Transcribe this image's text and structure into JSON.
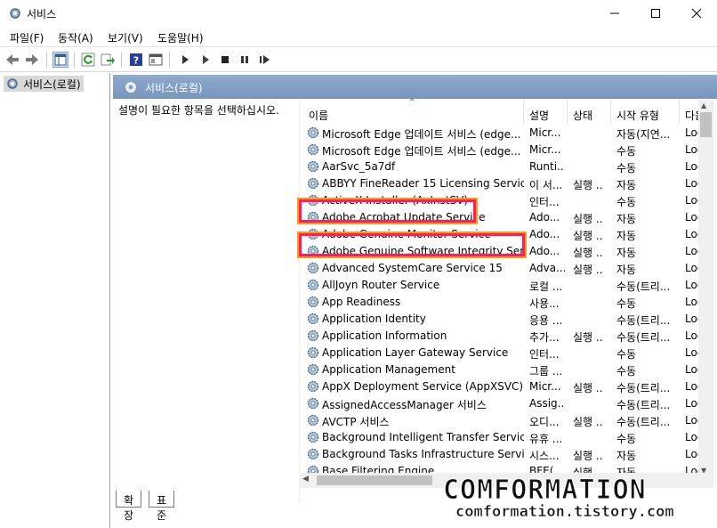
{
  "window": {
    "title": "서비스"
  },
  "menu": [
    "파일(F)",
    "동작(A)",
    "보기(V)",
    "도움말(H)"
  ],
  "tree": {
    "item": "서비스(로컬)"
  },
  "pane": {
    "header": "서비스(로컬)",
    "description": "설명이 필요한 항목을 선택하십시오."
  },
  "columns": {
    "name": "이름",
    "desc": "설명",
    "state": "상태",
    "startup": "시작 유형",
    "logon": "다음"
  },
  "services": [
    {
      "name": "Microsoft Edge 업데이트 서비스 (edge...",
      "desc": "Micr...",
      "state": "",
      "startup": "자동(지연...",
      "logon": "Loc"
    },
    {
      "name": "Microsoft Edge 업데이트 서비스 (edge...",
      "desc": "Micr...",
      "state": "",
      "startup": "수동",
      "logon": "Loc"
    },
    {
      "name": "AarSvc_5a7df",
      "desc": "Runti...",
      "state": "",
      "startup": "수동",
      "logon": "Loc"
    },
    {
      "name": "ABBYY FineReader 15 Licensing Service",
      "desc": "이 서...",
      "state": "실행 ...",
      "startup": "자동",
      "logon": "Loc"
    },
    {
      "name": "ActiveX Installer (AxInstSV)",
      "desc": "인터...",
      "state": "",
      "startup": "수동",
      "logon": "Loc"
    },
    {
      "name": "Adobe Acrobat Update Service",
      "desc": "Ado...",
      "state": "실행 ...",
      "startup": "자동",
      "logon": "Loc"
    },
    {
      "name": "Adobe Genuine Monitor Service",
      "desc": "Ado...",
      "state": "실행 ...",
      "startup": "자동",
      "logon": "Loc"
    },
    {
      "name": "Adobe Genuine Software Integrity Service",
      "desc": "Ado...",
      "state": "실행 ...",
      "startup": "자동",
      "logon": "Loc"
    },
    {
      "name": "Advanced SystemCare Service 15",
      "desc": "Adva...",
      "state": "실행 ...",
      "startup": "자동",
      "logon": "Loc"
    },
    {
      "name": "AllJoyn Router Service",
      "desc": "로컬 ...",
      "state": "",
      "startup": "수동(트리...",
      "logon": "Loc"
    },
    {
      "name": "App Readiness",
      "desc": "사용...",
      "state": "",
      "startup": "수동",
      "logon": "Loc"
    },
    {
      "name": "Application Identity",
      "desc": "응용 ...",
      "state": "",
      "startup": "수동(트리...",
      "logon": "Loc"
    },
    {
      "name": "Application Information",
      "desc": "추가...",
      "state": "실행 ...",
      "startup": "수동(트리...",
      "logon": "Loc"
    },
    {
      "name": "Application Layer Gateway Service",
      "desc": "인터...",
      "state": "",
      "startup": "수동",
      "logon": "Loc"
    },
    {
      "name": "Application Management",
      "desc": "그룹 ...",
      "state": "",
      "startup": "수동",
      "logon": "Loc"
    },
    {
      "name": "AppX Deployment Service (AppXSVC)",
      "desc": "Micr...",
      "state": "실행 ...",
      "startup": "수동(트리...",
      "logon": "Loc"
    },
    {
      "name": "AssignedAccessManager 서비스",
      "desc": "Assig...",
      "state": "",
      "startup": "수동(트리...",
      "logon": "Loc"
    },
    {
      "name": "AVCTP 서비스",
      "desc": "오디...",
      "state": "실행 ...",
      "startup": "수동(트리...",
      "logon": "Loc"
    },
    {
      "name": "Background Intelligent Transfer Service",
      "desc": "유휴 ...",
      "state": "",
      "startup": "수동",
      "logon": "Loc"
    },
    {
      "name": "Background Tasks Infrastructure Service",
      "desc": "시스...",
      "state": "실행 ...",
      "startup": "자동",
      "logon": "Loc"
    },
    {
      "name": "Base Filtering Engine",
      "desc": "BFE(...",
      "state": "실행 ...",
      "startup": "자동",
      "logon": "Loc"
    }
  ],
  "tabs": [
    "확장",
    "표준"
  ],
  "watermark": {
    "line1": "COMFORMATION",
    "line2": "comformation.tistory.com"
  },
  "highlight_colors": {
    "inner": "#ff1e5a",
    "outer": "#ff9a1a"
  }
}
